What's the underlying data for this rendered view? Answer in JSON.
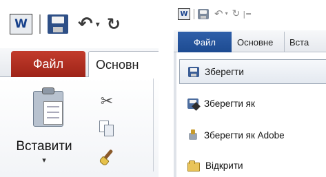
{
  "left": {
    "qat": {
      "app_logo": "W",
      "icons": [
        "word-logo-icon",
        "save-icon",
        "undo-icon",
        "dropdown-arrow-icon",
        "redo-icon"
      ]
    },
    "tabs": {
      "file": "Файл",
      "home": "Основн"
    },
    "clipboard": {
      "paste_label": "Вставити",
      "paste_arrow": "▾",
      "icons": [
        "scissors-icon",
        "copy-icon",
        "format-painter-icon"
      ]
    }
  },
  "right": {
    "qat": {
      "app_logo": "W",
      "undo_glyph": "↶",
      "drop_glyph": "▾",
      "redo_glyph": "↻",
      "customize_glyph": "|="
    },
    "tabs": {
      "file": "Файл",
      "home": "Основне",
      "insert": "Вста"
    },
    "menu": [
      {
        "label": "Зберегти",
        "icon": "save-icon",
        "highlighted": true
      },
      {
        "label": "Зберегти як",
        "icon": "save-as-icon",
        "highlighted": false
      },
      {
        "label": "Зберегти як Adobe",
        "icon": "save-as-pdf-icon",
        "highlighted": false
      },
      {
        "label": "Відкрити",
        "icon": "open-folder-icon",
        "highlighted": false
      }
    ]
  },
  "colors": {
    "file_tab_red": "#b3301f",
    "file_tab_blue": "#2457a0",
    "accent_navy": "#2e4f86"
  }
}
